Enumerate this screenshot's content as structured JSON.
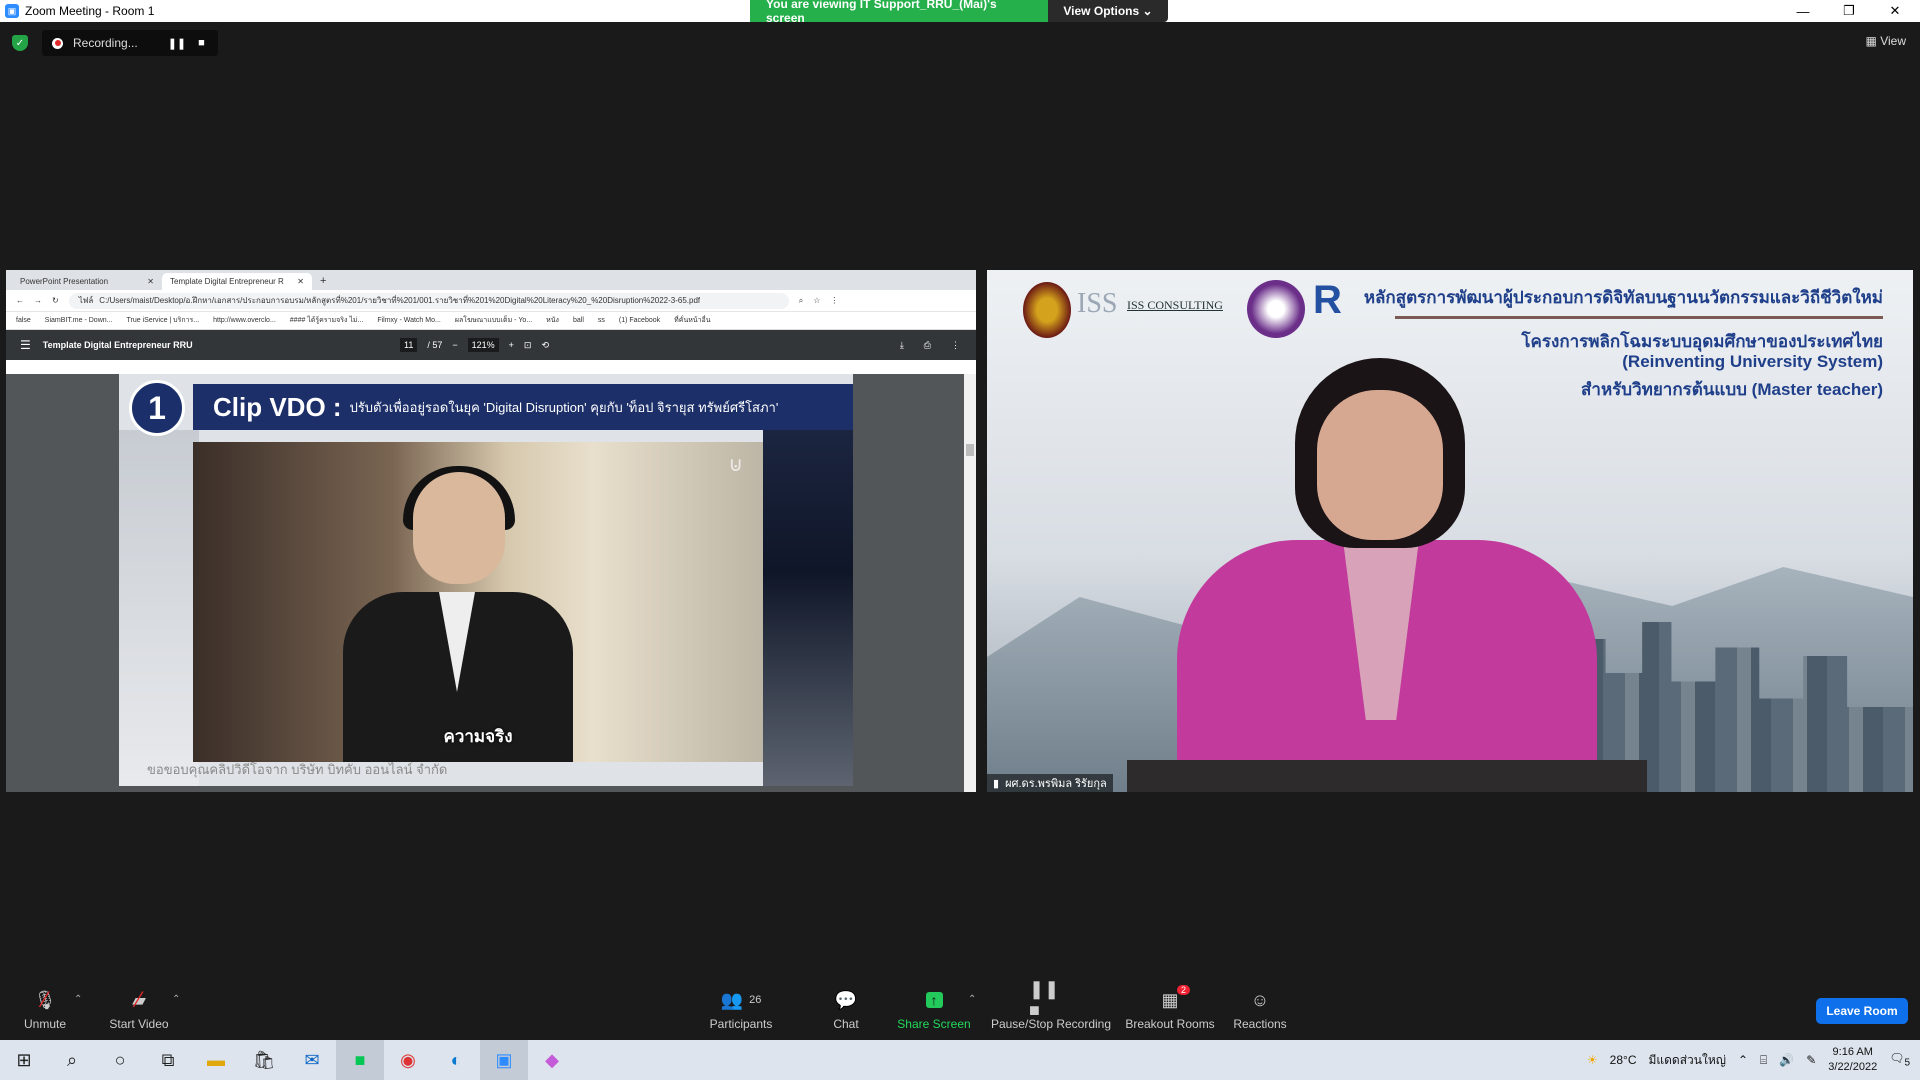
{
  "window": {
    "title": "Zoom Meeting - Room 1"
  },
  "share_banner": {
    "text": "You are viewing IT Support_RRU_(Mai)'s screen",
    "view_options": "View Options"
  },
  "recording": {
    "label": "Recording..."
  },
  "view_button": "View",
  "browser": {
    "tabs": [
      "PowerPoint Presentation",
      "Template Digital Entrepreneur R"
    ],
    "url_prefix": "ไฟล์",
    "url": "C:/Users/maist/Desktop/อ.ฝึกหา/เอกสาร/ประกอบการอบรม/หลักสูตรที่%201/รายวิชาที่%201/001.รายวิชาที่%201%20Digital%20Literacy%20_%20Disruption%2022-3-65.pdf",
    "bookmarks": [
      "false",
      "SiamBIT.me - Down...",
      "True iService | บริการ...",
      "http://www.overclo...",
      "#### ได้รู้ครามจริง ไม่...",
      "Filmxy - Watch Mo...",
      "ผลโฆษณาแบบเต็ม - Yo...",
      "หนัง",
      "ball",
      "ss",
      "(1) Facebook",
      "ที่คั่นหน้าอื่น"
    ]
  },
  "pdf": {
    "doc_title": "Template Digital Entrepreneur RRU",
    "page": "11",
    "page_total": "/ 57",
    "zoom": "121%"
  },
  "slide": {
    "number": "1",
    "title_big": "Clip VDO :",
    "title_small": "ปรับตัวเพื่ออยู่รอดในยุค 'Digital Disruption' คุยกับ 'ท็อป จิรายุส ทรัพย์ศรีโสภา'",
    "subtitle": "ความจริง",
    "credit": "ขอขอบคุณคลิปวิดีโอจาก บริษัท บิทคับ ออนไลน์ จำกัด"
  },
  "speaker": {
    "iss_big": "ISS",
    "iss_text": "ISS CONSULTING",
    "heading1": "หลักสูตรการพัฒนาผู้ประกอบการดิจิทัลบนฐานนวัตกรรมและวิถีชีวิตใหม่",
    "heading2": "โครงการพลิกโฉมระบบอุดมศึกษาของประเทศไทย",
    "heading3": "(Reinventing University System)",
    "heading4": "สำหรับวิทยากรต้นแบบ (Master teacher)",
    "name": "ผศ.ดร.พรพิมล ริรัยกุล"
  },
  "controls": {
    "unmute": "Unmute",
    "start_video": "Start Video",
    "participants": "Participants",
    "participants_count": "26",
    "chat": "Chat",
    "share_screen": "Share Screen",
    "pause_stop": "Pause/Stop Recording",
    "breakout": "Breakout Rooms",
    "breakout_badge": "2",
    "reactions": "Reactions",
    "leave": "Leave Room"
  },
  "taskbar": {
    "temperature": "28°C",
    "weather": "มีแดดส่วนใหญ่",
    "time": "9:16 AM",
    "date": "3/22/2022",
    "notif_count": "5"
  },
  "colors": {
    "zoom_blue": "#0e71eb",
    "share_green": "#26b04c",
    "slide_navy": "#1c2f69",
    "jacket": "#c23a9c"
  }
}
